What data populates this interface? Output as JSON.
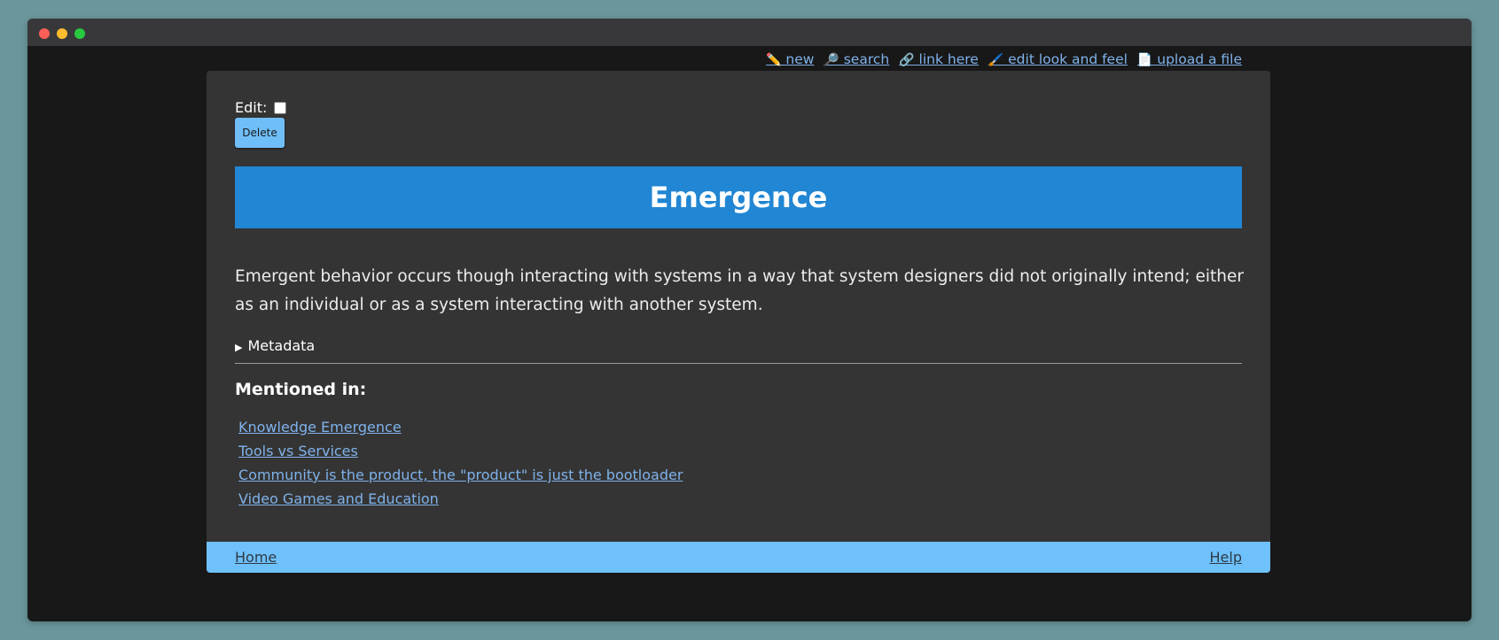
{
  "window": {
    "controls": [
      "close",
      "minimize",
      "maximize"
    ]
  },
  "topnav": {
    "items": [
      {
        "icon": "pencil-icon",
        "glyph": "✏️",
        "label": "new"
      },
      {
        "icon": "magnifier-icon",
        "glyph": "🔎",
        "label": "search"
      },
      {
        "icon": "link-icon",
        "glyph": "🔗",
        "label": "link here"
      },
      {
        "icon": "paintbrush-icon",
        "glyph": "🖌️",
        "label": "edit look and feel"
      },
      {
        "icon": "document-icon",
        "glyph": "📄",
        "label": "upload a file"
      }
    ]
  },
  "edit": {
    "label": "Edit:",
    "checked": false,
    "delete_label": "Delete"
  },
  "page": {
    "title": "Emergence",
    "body": "Emergent behavior occurs though interacting with systems in a way that system designers did not originally intend; either as an individual or as a system interacting with another system.",
    "metadata_label": "Metadata"
  },
  "mentioned": {
    "heading": "Mentioned in:",
    "links": [
      "Knowledge Emergence",
      "Tools vs Services",
      "Community is the product, the \"product\" is just the bootloader",
      "Video Games and Education"
    ]
  },
  "footer": {
    "home": "Home",
    "help": "Help"
  },
  "colors": {
    "desktop_bg": "#6b979c",
    "window_bg": "#181818",
    "card_bg": "#343434",
    "title_banner": "#2186d3",
    "delete_button": "#6fbef8",
    "footer_bg": "#6fc1fb",
    "link": "#7fb2ea"
  }
}
